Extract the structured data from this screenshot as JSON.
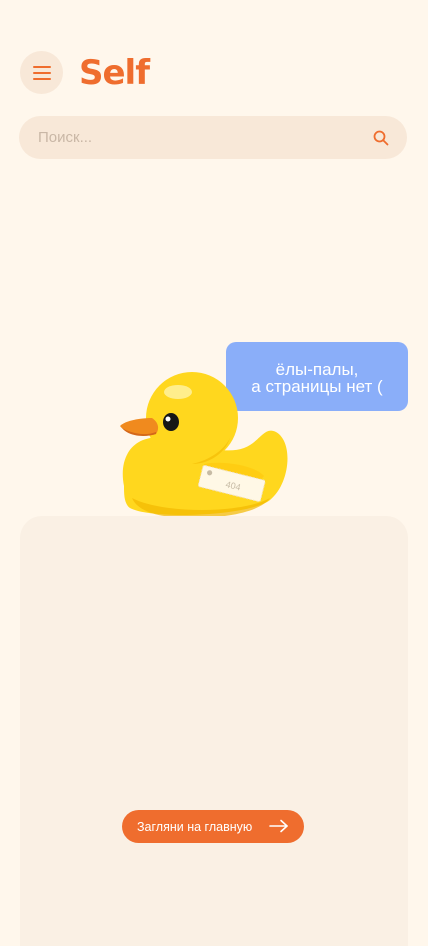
{
  "header": {
    "logo_text": "Self",
    "menu_icon": "hamburger-menu-icon"
  },
  "search": {
    "placeholder": "Поиск...",
    "value": "",
    "icon": "search-icon"
  },
  "error": {
    "bubble_line1": "ёлы-палы,",
    "bubble_line2": "а страницы нет (",
    "tag_text": "404"
  },
  "actions": {
    "home_button_label": "Загляни на главную",
    "home_button_icon": "arrow-right-icon"
  },
  "colors": {
    "background": "#FFF7EC",
    "accent": "#EF6D2E",
    "surface": "#F8E8D8",
    "card": "#FAF0E4",
    "bubble": "#8AAEF9",
    "duck": "#FFD71E"
  }
}
